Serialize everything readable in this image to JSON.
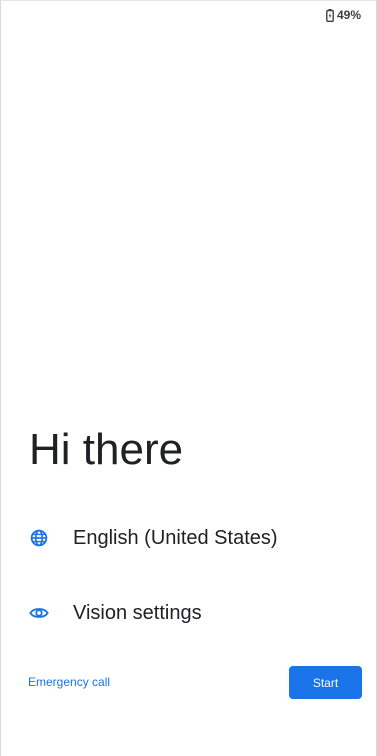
{
  "status_bar": {
    "battery_icon": "battery-charging-icon",
    "battery_text": "49%"
  },
  "welcome": {
    "title": "Hi there"
  },
  "options": {
    "language": {
      "icon": "globe-icon",
      "label": "English (United States)"
    },
    "vision": {
      "icon": "eye-icon",
      "label": "Vision settings"
    }
  },
  "footer": {
    "emergency_label": "Emergency call",
    "start_label": "Start"
  },
  "colors": {
    "accent": "#1a73e8",
    "text": "#202124",
    "background": "#ffffff"
  }
}
